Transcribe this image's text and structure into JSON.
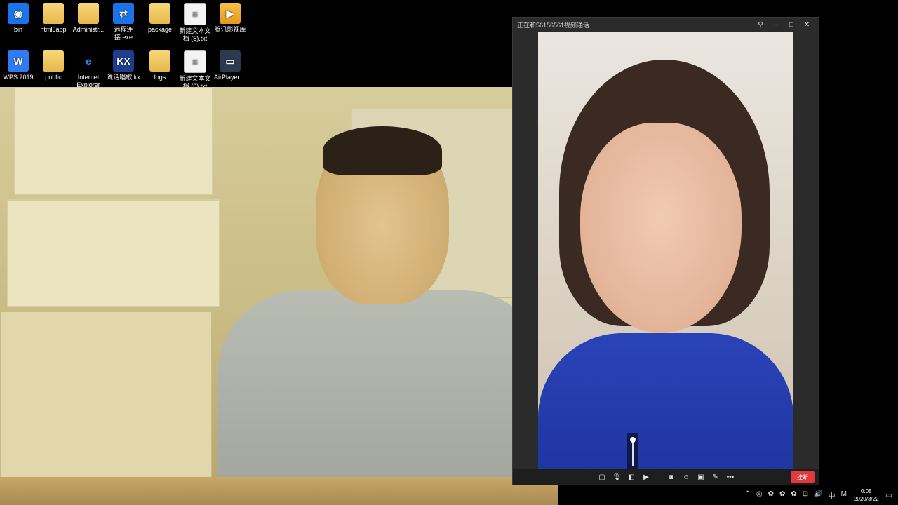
{
  "desktop": {
    "icons": [
      {
        "label": "bin",
        "glyph": "◉",
        "style": "g-blue",
        "icon": "recycle-bin-icon"
      },
      {
        "label": "html5app",
        "glyph": "",
        "style": "g-folder",
        "icon": "folder-icon"
      },
      {
        "label": "Administr...",
        "glyph": "",
        "style": "g-admin",
        "icon": "user-folder-icon"
      },
      {
        "label": "远程连接.exe",
        "glyph": "⇄",
        "style": "g-blue",
        "icon": "teamviewer-icon"
      },
      {
        "label": "package",
        "glyph": "",
        "style": "g-folder",
        "icon": "folder-icon"
      },
      {
        "label": "新建文本文档 (5).txt",
        "glyph": "≡",
        "style": "g-file",
        "icon": "text-file-icon"
      },
      {
        "label": "腾讯影视库",
        "glyph": "▶",
        "style": "g-player",
        "icon": "video-library-icon"
      },
      {
        "label": "WPS 2019",
        "glyph": "W",
        "style": "g-wps",
        "icon": "wps-icon"
      },
      {
        "label": "public",
        "glyph": "",
        "style": "g-folder",
        "icon": "folder-icon"
      },
      {
        "label": "Internet Explorer",
        "glyph": "e",
        "style": "g-ie",
        "icon": "internet-explorer-icon"
      },
      {
        "label": "说话唱歌.kx",
        "glyph": "KX",
        "style": "g-kk",
        "icon": "kx-file-icon"
      },
      {
        "label": "logs",
        "glyph": "",
        "style": "g-folder",
        "icon": "folder-icon"
      },
      {
        "label": "新建文本文档 (6).txt",
        "glyph": "≡",
        "style": "g-file",
        "icon": "text-file-icon"
      },
      {
        "label": "AirPlayer....",
        "glyph": "▭",
        "style": "g-air",
        "icon": "airplayer-icon"
      }
    ]
  },
  "call_window": {
    "title": "正在和56156561视频通话",
    "pin_glyph": "⚲",
    "minimize_glyph": "–",
    "maximize_glyph": "□",
    "close_glyph": "✕",
    "toolbar": {
      "icons": [
        {
          "glyph": "▢",
          "name": "chat-icon"
        },
        {
          "glyph": "🎙",
          "name": "microphone-icon"
        },
        {
          "glyph": "◧",
          "name": "speaker-icon"
        },
        {
          "glyph": "▶",
          "name": "camera-icon"
        },
        {
          "glyph": "◙",
          "name": "screenshot-icon"
        },
        {
          "glyph": "☺",
          "name": "effects-icon"
        },
        {
          "glyph": "▣",
          "name": "screen-share-icon"
        },
        {
          "glyph": "✎",
          "name": "whiteboard-icon"
        },
        {
          "glyph": "•••",
          "name": "more-icon"
        }
      ],
      "hangup_label": "挂断"
    },
    "volume_level": 1.0
  },
  "taskbar": {
    "tray_icons": [
      "⌃",
      "◎",
      "✿",
      "✿",
      "✿",
      "⊡",
      "🔊",
      "中",
      "M"
    ],
    "time": "0:05",
    "date": "2020/3/22",
    "notification_glyph": "▭"
  }
}
